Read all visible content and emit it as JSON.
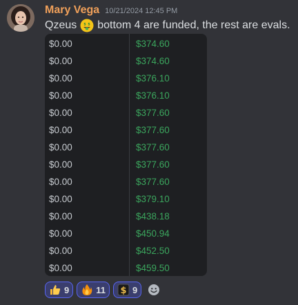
{
  "message": {
    "username": "Mary Vega",
    "timestamp": "10/21/2024 12:45 PM",
    "text_before": "Qzeus",
    "text_after": "bottom 4 are funded, the rest are evals.",
    "inline_emoji": "money-mouth-face-icon"
  },
  "table": {
    "rows": [
      {
        "left": "$0.00",
        "right": "$374.60"
      },
      {
        "left": "$0.00",
        "right": "$374.60"
      },
      {
        "left": "$0.00",
        "right": "$376.10"
      },
      {
        "left": "$0.00",
        "right": "$376.10"
      },
      {
        "left": "$0.00",
        "right": "$377.60"
      },
      {
        "left": "$0.00",
        "right": "$377.60"
      },
      {
        "left": "$0.00",
        "right": "$377.60"
      },
      {
        "left": "$0.00",
        "right": "$377.60"
      },
      {
        "left": "$0.00",
        "right": "$377.60"
      },
      {
        "left": "$0.00",
        "right": "$379.10"
      },
      {
        "left": "$0.00",
        "right": "$438.18"
      },
      {
        "left": "$0.00",
        "right": "$450.94"
      },
      {
        "left": "$0.00",
        "right": "$452.50"
      },
      {
        "left": "$0.00",
        "right": "$459.50"
      }
    ]
  },
  "reactions": [
    {
      "icon": "thumbs-up-icon",
      "count": "9"
    },
    {
      "icon": "fire-icon",
      "count": "11"
    },
    {
      "icon": "heavy-dollar-sign-icon",
      "count": "9"
    }
  ],
  "colors": {
    "background": "#323338",
    "username": "#f0a05a",
    "profit_green": "#3ba55d",
    "reaction_border": "#5865f2"
  }
}
